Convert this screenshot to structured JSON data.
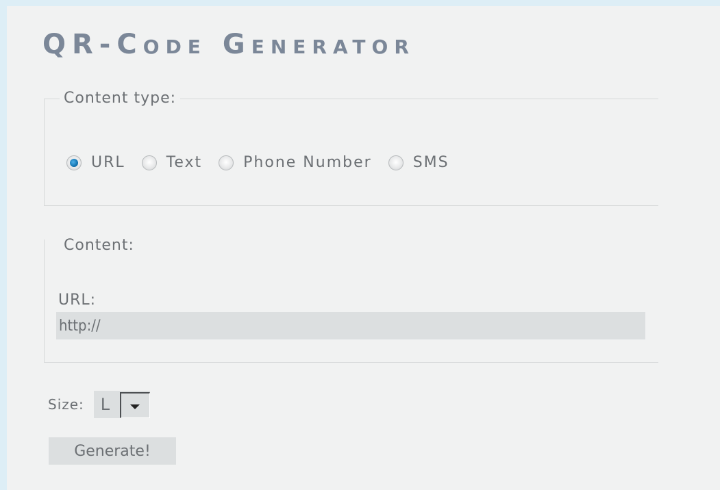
{
  "page": {
    "title": "QR-Code Generator"
  },
  "content_type": {
    "legend": "Content type:",
    "options": [
      {
        "label": "URL",
        "checked": true
      },
      {
        "label": "Text",
        "checked": false
      },
      {
        "label": "Phone Number",
        "checked": false
      },
      {
        "label": "SMS",
        "checked": false
      }
    ]
  },
  "content": {
    "legend": "Content:",
    "url_label": "URL:",
    "url_value": "http://"
  },
  "size": {
    "label": "Size:",
    "value": "L"
  },
  "generate_label": "Generate!"
}
